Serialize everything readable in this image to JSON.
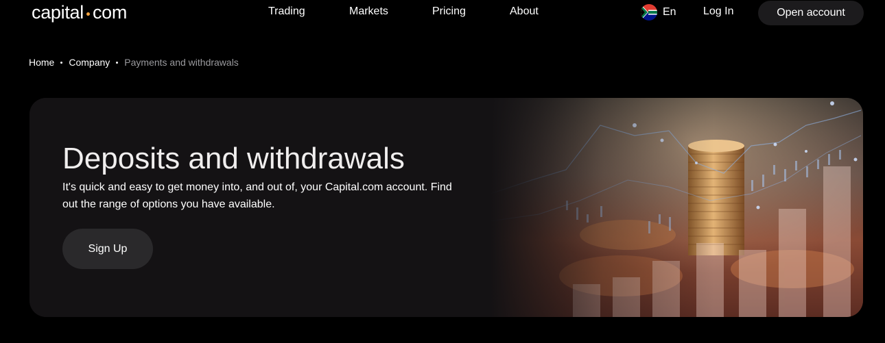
{
  "header": {
    "logo_left": "capital",
    "logo_right": "com",
    "nav": [
      "Trading",
      "Markets",
      "Pricing",
      "About"
    ],
    "language": "En",
    "login_label": "Log In",
    "open_account_label": "Open account"
  },
  "breadcrumb": {
    "items": [
      "Home",
      "Company"
    ],
    "current": "Payments and withdrawals"
  },
  "hero": {
    "title": "Deposits and withdrawals",
    "description": "It's quick and easy to get money into, and out of, your Capital.com account. Find out the range of options you have available.",
    "signup_label": "Sign Up"
  },
  "colors": {
    "background": "#000000",
    "card": "#141214",
    "button": "#2a292b",
    "logo_dot": "#f4a340",
    "breadcrumb_current": "#9a9a9e"
  },
  "icons": {
    "language_flag": "south-africa-flag-icon"
  }
}
